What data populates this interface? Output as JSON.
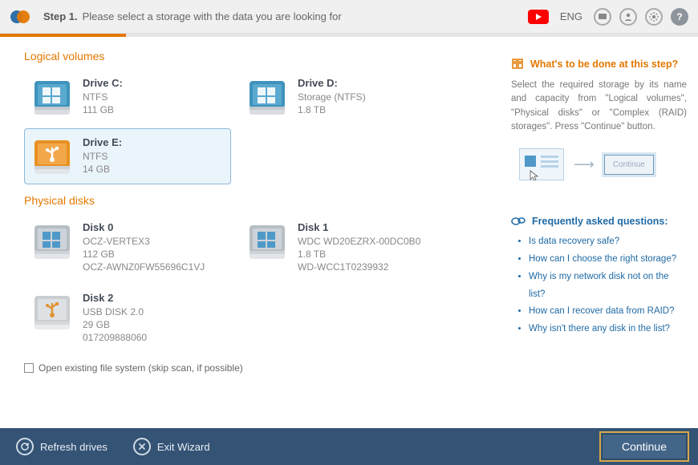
{
  "header": {
    "step_label": "Step 1.",
    "step_text": "Please select a storage with the data you are looking for",
    "lang": "ENG"
  },
  "sections": {
    "logical_title": "Logical volumes",
    "physical_title": "Physical disks"
  },
  "logical": [
    {
      "title": "Drive C:",
      "fs": "NTFS",
      "size": "111 GB",
      "kind": "hdd"
    },
    {
      "title": "Drive D:",
      "fs": "Storage (NTFS)",
      "size": "1.8 TB",
      "kind": "hdd"
    },
    {
      "title": "Drive E:",
      "fs": "NTFS",
      "size": "14 GB",
      "kind": "usb"
    }
  ],
  "physical": [
    {
      "title": "Disk 0",
      "model": "OCZ-VERTEX3",
      "size": "112 GB",
      "serial": "OCZ-AWNZ0FW55696C1VJ",
      "kind": "hdd"
    },
    {
      "title": "Disk 1",
      "model": "WDC WD20EZRX-00DC0B0",
      "size": "1.8 TB",
      "serial": "WD-WCC1T0239932",
      "kind": "hdd"
    },
    {
      "title": "Disk 2",
      "model": "USB DISK 2.0",
      "size": "29 GB",
      "serial": "017209888060",
      "kind": "usb"
    }
  ],
  "checkbox_label": "Open existing file system (skip scan, if possible)",
  "right": {
    "heading": "What's to be done at this step?",
    "text": "Select the required storage by its name and capacity from \"Logical volumes\", \"Physical disks\" or \"Complex (RAID) storages\". Press \"Continue\" button.",
    "mini_continue": "Continue",
    "faq_heading": "Frequently asked questions:",
    "faq": [
      "Is data recovery safe?",
      "How can I choose the right storage?",
      "Why is my network disk not on the list?",
      "How can I recover data from RAID?",
      "Why isn't there any disk in the list?"
    ]
  },
  "bottom": {
    "refresh": "Refresh drives",
    "exit": "Exit Wizard",
    "continue": "Continue"
  }
}
